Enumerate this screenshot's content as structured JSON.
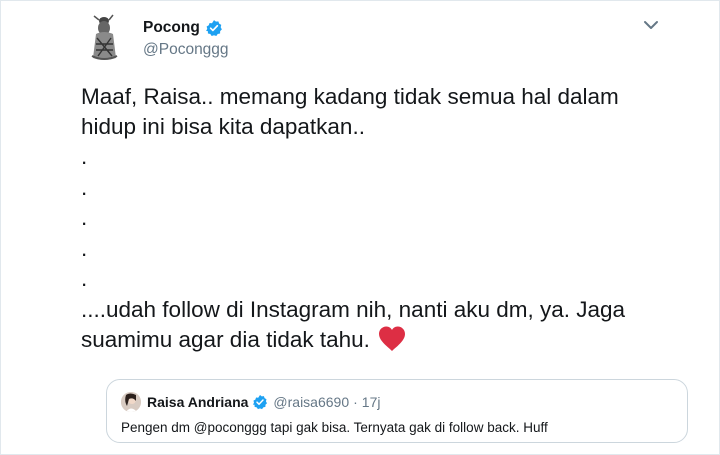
{
  "tweet": {
    "author_name": "Pocong",
    "author_handle": "@Poconggg",
    "text_lines": [
      "Maaf, Raisa.. memang kadang tidak semua hal dalam",
      "hidup ini bisa kita dapatkan..",
      ".",
      ".",
      ".",
      ".",
      ".",
      "....udah follow di Instagram nih, nanti aku dm, ya. Jaga",
      "suamimu agar dia tidak tahu."
    ],
    "emoji": "heart-emoji"
  },
  "quoted_tweet": {
    "author_name": "Raisa Andriana",
    "author_handle": "@raisa6690",
    "separator": "·",
    "time": "17j",
    "text": "Pengen dm @poconggg tapi gak bisa. Ternyata gak di follow back. Huff"
  },
  "icons": {
    "verified": "verified-badge-icon",
    "menu": "chevron-down-icon"
  },
  "colors": {
    "verified_blue": "#1da1f2",
    "heart_red": "#dd2e44",
    "secondary_text": "#657786",
    "border": "#ccd6dd"
  }
}
